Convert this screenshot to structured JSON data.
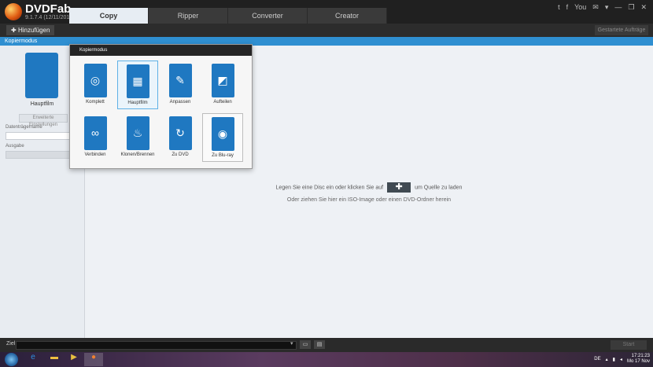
{
  "app": {
    "name": "DVDFab",
    "version": "9.1.7.4 (12/11/2014)"
  },
  "tabs": [
    "Copy",
    "Ripper",
    "Converter",
    "Creator"
  ],
  "window_controls": [
    "t",
    "f",
    "You",
    "✉",
    "▾",
    "—",
    "❐",
    "✕"
  ],
  "toolbar": {
    "add_label": "Hinzufügen",
    "tasks_label": "Gestartete Aufträge"
  },
  "modebar_label": "Kopiermodus",
  "left": {
    "selected_mode_label": "Hauptfilm",
    "advanced_button": "Erweiterte Einstellungen",
    "volume_label": "Datenträgername",
    "output_label": "Ausgabe"
  },
  "popup": {
    "title": "Kopiermodus",
    "modes": [
      {
        "label": "Komplett",
        "icon": "disc-icon",
        "glyph": "◎"
      },
      {
        "label": "Hauptfilm",
        "icon": "film-icon",
        "glyph": "▦"
      },
      {
        "label": "Anpassen",
        "icon": "customize-icon",
        "glyph": "✎"
      },
      {
        "label": "Aufteilen",
        "icon": "split-icon",
        "glyph": "◩"
      },
      {
        "label": "Verbinden",
        "icon": "link-icon",
        "glyph": "∞"
      },
      {
        "label": "Klonen/Brennen",
        "icon": "burn-icon",
        "glyph": "♨"
      },
      {
        "label": "Zu DVD",
        "icon": "to-dvd-icon",
        "glyph": "↻"
      },
      {
        "label": "Zu Blu-ray",
        "icon": "to-bluray-icon",
        "glyph": "◉"
      }
    ]
  },
  "main": {
    "hint_before": "Legen Sie eine Disc ein oder klicken Sie auf",
    "hint_after": "um Quelle zu laden",
    "hint_line2": "Oder ziehen Sie hier ein ISO-Image oder einen DVD-Ordner herein"
  },
  "bottom": {
    "ziel_label": "Ziel",
    "start_label": "Start"
  },
  "taskbar": {
    "lang": "DE",
    "time": "17:21:23",
    "date": "Mo 17 Nov"
  },
  "colors": {
    "accent": "#2f8fd1",
    "icon_blue": "#1f78c1"
  }
}
